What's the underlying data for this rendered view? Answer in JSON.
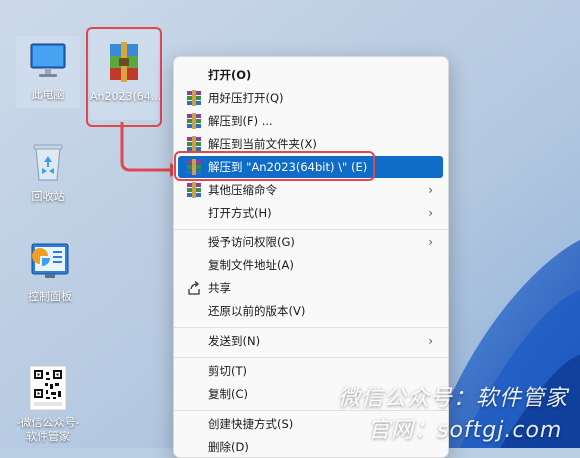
{
  "desktop": {
    "icons": [
      {
        "label": "此电脑"
      },
      {
        "label": "An2023(64..."
      },
      {
        "label": "回收站"
      },
      {
        "label": "控制面板"
      },
      {
        "label": "-微信公众号-\n软件管家"
      }
    ]
  },
  "context_menu": {
    "items": [
      {
        "label": "打开(O)"
      },
      {
        "label": "用好压打开(Q)"
      },
      {
        "label": "解压到(F) ..."
      },
      {
        "label": "解压到当前文件夹(X)"
      },
      {
        "label": "解压到 \"An2023(64bit)  \\\" (E)"
      },
      {
        "label": "其他压缩命令"
      },
      {
        "label": "打开方式(H)"
      },
      {
        "label": "授予访问权限(G)"
      },
      {
        "label": "复制文件地址(A)"
      },
      {
        "label": "共享"
      },
      {
        "label": "还原以前的版本(V)"
      },
      {
        "label": "发送到(N)"
      },
      {
        "label": "剪切(T)"
      },
      {
        "label": "复制(C)"
      },
      {
        "label": "创建快捷方式(S)"
      },
      {
        "label": "删除(D)"
      }
    ]
  },
  "watermark": {
    "line1": "微信公众号：软件管家",
    "line2": "官网：softgj.com"
  },
  "colors": {
    "highlight": "#0f6cc8",
    "annotation": "#e0484e"
  }
}
